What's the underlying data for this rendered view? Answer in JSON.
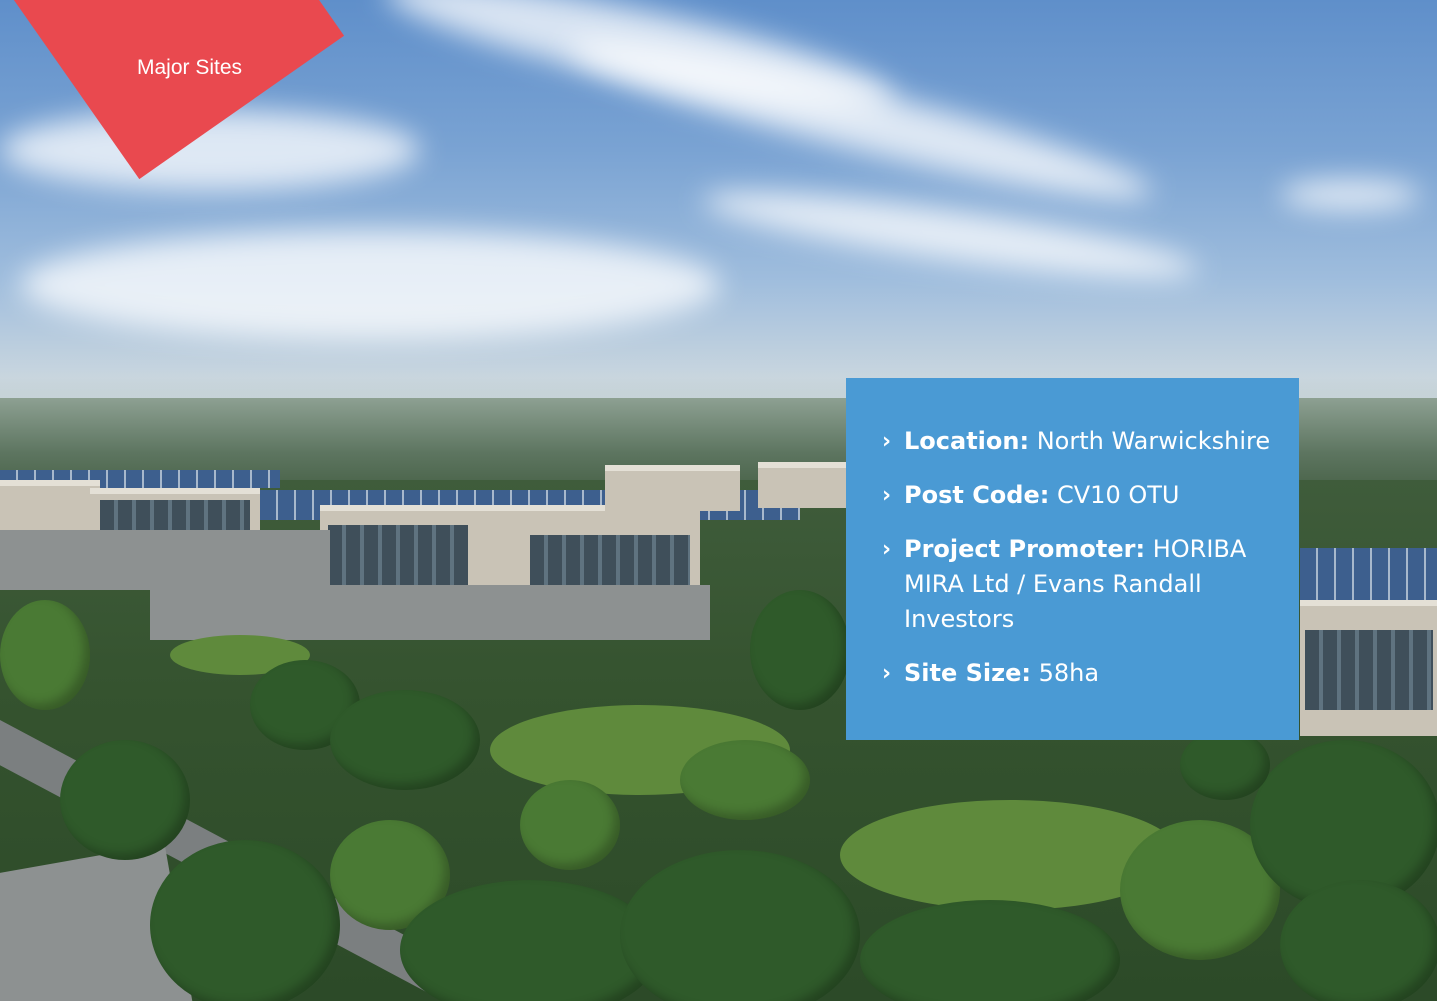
{
  "tag": {
    "label": "Major Sites",
    "color": "#e9494f"
  },
  "info_box": {
    "background": "#4a9ad4",
    "items": [
      {
        "label": "Location:",
        "value": "North Warwickshire"
      },
      {
        "label": "Post Code:",
        "value": "CV10 OTU"
      },
      {
        "label": "Project Promoter:",
        "value": "HORIBA MIRA Ltd / Evans Randall Investors"
      },
      {
        "label": "Site Size:",
        "value": "58ha"
      }
    ],
    "bullet_icon": "chevron-right-icon"
  }
}
